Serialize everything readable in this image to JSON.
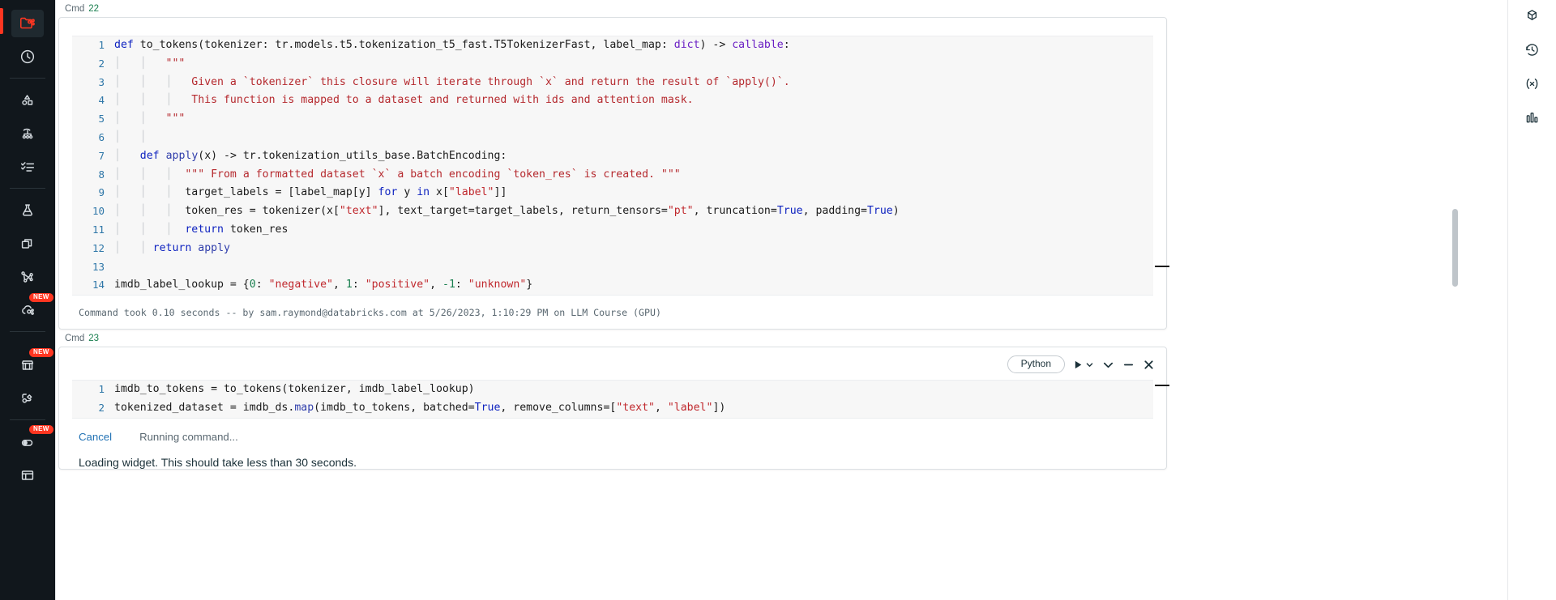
{
  "sidebar": {
    "items": [
      {
        "name": "workspace-icon",
        "badge": null
      },
      {
        "name": "recents-clock-icon",
        "badge": null
      },
      {
        "name": "catalog-shapes-icon",
        "badge": null
      },
      {
        "name": "workflows-icon",
        "badge": null
      },
      {
        "name": "tasks-checklist-icon",
        "badge": null
      },
      {
        "name": "experiments-flask-icon",
        "badge": null
      },
      {
        "name": "compute-stack-icon",
        "badge": null
      },
      {
        "name": "graph-network-icon",
        "badge": null
      },
      {
        "name": "serving-cloud-icon",
        "badge": "NEW"
      },
      {
        "name": "marketplace-icon",
        "badge": "NEW"
      },
      {
        "name": "partner-connect-icon",
        "badge": null
      },
      {
        "name": "preview-toggle-icon",
        "badge": "NEW"
      },
      {
        "name": "sql-editor-icon",
        "badge": null
      }
    ]
  },
  "right_rail": {
    "items": [
      {
        "name": "schema-browser-icon"
      },
      {
        "name": "revision-history-icon"
      },
      {
        "name": "variable-explorer-icon"
      },
      {
        "name": "mlflow-experiment-icon"
      }
    ]
  },
  "cell1": {
    "label": "Cmd",
    "number": "22",
    "lines": [
      {
        "n": "1",
        "html": "<span class=\"kw\">def</span> to_tokens(tokenizer: tr.models.t5.tokenization_t5_fast.T5TokenizerFast, label_map: <span class=\"kw2\">dict</span>) -&gt; <span class=\"kw2\">callable</span>:"
      },
      {
        "n": "2",
        "html": "<span class=\"ind\">│   │</span>   <span class=\"doc\">\"\"\"</span>"
      },
      {
        "n": "3",
        "html": "<span class=\"ind\">│   │   │</span>   <span class=\"doc\">Given a `tokenizer` this closure will iterate through `x` and return the result of `apply()`.</span>"
      },
      {
        "n": "4",
        "html": "<span class=\"ind\">│   │   │</span>   <span class=\"doc\">This function is mapped to a dataset and returned with ids and attention mask.</span>"
      },
      {
        "n": "5",
        "html": "<span class=\"ind\">│   │</span>   <span class=\"doc\">\"\"\"</span>"
      },
      {
        "n": "6",
        "html": "<span class=\"ind\">│   │</span>"
      },
      {
        "n": "7",
        "html": "<span class=\"ind\">│</span>   <span class=\"kw\">def</span> <span class=\"fn\">apply</span>(x) -&gt; tr.tokenization_utils_base.BatchEncoding:"
      },
      {
        "n": "8",
        "html": "<span class=\"ind\">│   │   │</span>  <span class=\"doc\">\"\"\" From a formatted dataset `x` a batch encoding `token_res` is created. \"\"\"</span>"
      },
      {
        "n": "9",
        "html": "<span class=\"ind\">│   │   │</span>  target_labels = [label_map[y] <span class=\"kw\">for</span> y <span class=\"kw\">in</span> x[<span class=\"str\">\"label\"</span>]]"
      },
      {
        "n": "10",
        "html": "<span class=\"ind\">│   │   │</span>  token_res = tokenizer(x[<span class=\"str\">\"text\"</span>], text_target=target_labels, return_tensors=<span class=\"str\">\"pt\"</span>, truncation=<span class=\"bool\">True</span>, padding=<span class=\"bool\">True</span>)"
      },
      {
        "n": "11",
        "html": "<span class=\"ind\">│   │   │</span>  <span class=\"kw\">return</span> token_res"
      },
      {
        "n": "12",
        "html": "<span class=\"ind\">│   │</span> <span class=\"kw\">return</span> <span class=\"fn\">apply</span>"
      },
      {
        "n": "13",
        "html": ""
      },
      {
        "n": "14",
        "html": "imdb_label_lookup = {<span class=\"num\">0</span>: <span class=\"str\">\"negative\"</span>, <span class=\"num\">1</span>: <span class=\"str\">\"positive\"</span>, <span class=\"num\">-1</span>: <span class=\"str\">\"unknown\"</span>}"
      }
    ],
    "footer": "Command took 0.10 seconds -- by sam.raymond@databricks.com at 5/26/2023, 1:10:29 PM on LLM Course (GPU)"
  },
  "cell2": {
    "label": "Cmd",
    "number": "23",
    "toolbar": {
      "language": "Python",
      "run_icon": "run-play-icon",
      "run_caret_icon": "chevron-down-icon",
      "collapse_icon": "chevron-down-icon",
      "minimize_icon": "minimize-dash-icon",
      "close_icon": "close-x-icon"
    },
    "lines": [
      {
        "n": "1",
        "html": "imdb_to_tokens = to_tokens(tokenizer, imdb_label_lookup)"
      },
      {
        "n": "2",
        "html": "tokenized_dataset = imdb_ds.<span class=\"fn\">map</span>(imdb_to_tokens, batched=<span class=\"bool\">True</span>, remove_columns=[<span class=\"str\">\"text\"</span>, <span class=\"str\">\"label\"</span>])"
      }
    ],
    "cancel_label": "Cancel",
    "status_text": "Running command...",
    "widget_message": "Loading widget. This should take less than 30 seconds."
  },
  "colors": {
    "accent_red": "#ff3621",
    "sidebar_bg": "#11171c",
    "link_blue": "#2272b4",
    "editor_bg": "#f7f7f7",
    "gutter_text": "#2f77a8"
  }
}
